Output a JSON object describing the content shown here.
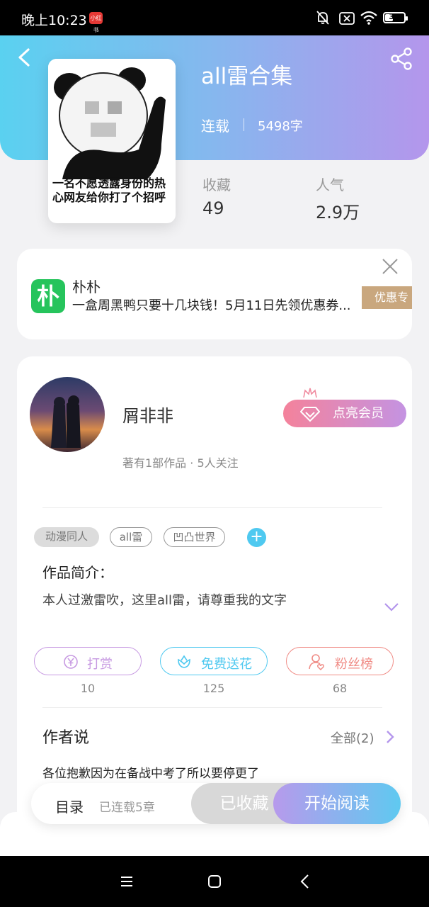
{
  "status_bar": {
    "time": "晚上10:23",
    "app_badge": "小红书",
    "battery": "38"
  },
  "book": {
    "title": "all雷合集",
    "status": "连载",
    "word_count": "5498字",
    "cover_caption_line1": "一名不愿透露身份的热",
    "cover_caption_line2": "心网友给你打了个招呼",
    "stats": [
      {
        "label": "收藏",
        "value": "49"
      },
      {
        "label": "人气",
        "value": "2.9万"
      }
    ]
  },
  "ad": {
    "logo_char": "朴",
    "name": "朴朴",
    "text": "一盒周黑鸭只要十几块钱！5月11日先领优惠券...",
    "tag": "优惠专"
  },
  "author": {
    "name": "屑非非",
    "meta": "著有1部作品 · 5人关注",
    "vip_label": "点亮会员"
  },
  "tags": [
    {
      "label": "动漫同人",
      "style": "filled"
    },
    {
      "label": "all雷",
      "style": "outline"
    },
    {
      "label": "凹凸世界",
      "style": "outline"
    }
  ],
  "tag_add": "+",
  "intro": {
    "title": "作品简介：",
    "text": "本人过激雷吹，这里all雷，请尊重我的文字"
  },
  "actions": [
    {
      "label": "打赏",
      "count": "10",
      "color": "#c79ae2",
      "icon": "yen-icon"
    },
    {
      "label": "免费送花",
      "count": "125",
      "color": "#4fc9f0",
      "icon": "flower-icon"
    },
    {
      "label": "粉丝榜",
      "count": "68",
      "color": "#f08c86",
      "icon": "fan-rank-icon"
    }
  ],
  "author_says": {
    "title": "作者说",
    "all_label": "全部(2)",
    "text": "各位抱歉因为在备战中考了所以要停更了"
  },
  "bottom_bar": {
    "toc_label": "目录",
    "toc_count": "已连载5章",
    "fav_label": "已收藏",
    "read_label": "开始阅读"
  },
  "colors": {
    "accent_blue": "#4fc9f0",
    "accent_purple": "#b496ec",
    "ad_green": "#26c45c"
  }
}
